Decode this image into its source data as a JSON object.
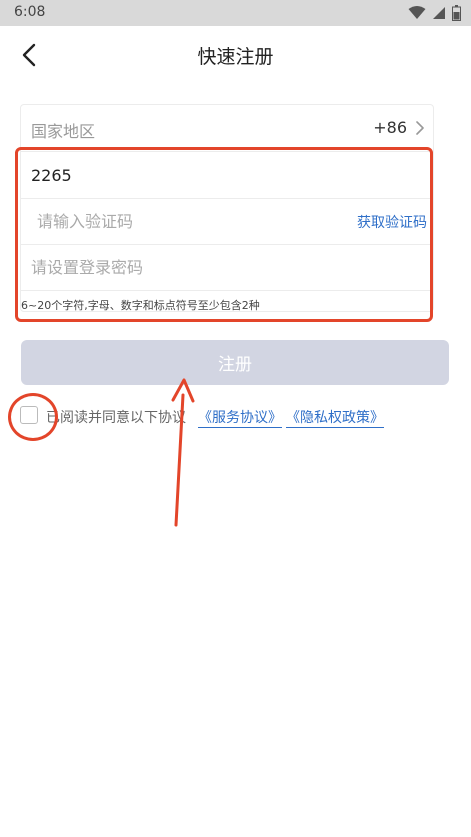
{
  "status_bar": {
    "time": "6:08",
    "icons": [
      "wifi-icon",
      "signal-icon",
      "battery-icon"
    ]
  },
  "nav": {
    "back_icon": "chevron-left-icon",
    "title": "快速注册"
  },
  "form": {
    "country_label": "国家地区",
    "country_code": "+86",
    "phone_value": "2265",
    "code_placeholder": "请输入验证码",
    "get_code_label": "获取验证码",
    "password_placeholder": "请设置登录密码",
    "password_hint": "6~20个字符,字母、数字和标点符号至少包含2种"
  },
  "register_button": {
    "label": "注册"
  },
  "agreement": {
    "text": "已阅读并同意以下协议",
    "service_link": "《服务协议》",
    "privacy_link": "《隐私权政策》"
  },
  "colors": {
    "annotation": "#e3452a",
    "link": "#2f6fc8",
    "button_disabled": "#d2d5e2"
  }
}
